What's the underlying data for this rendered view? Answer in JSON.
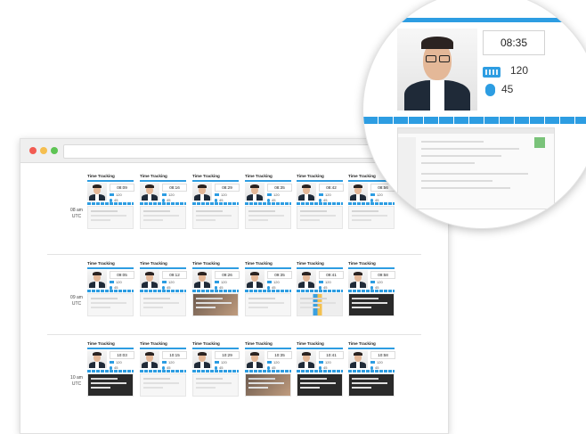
{
  "widget_title": "Time Tracking",
  "hours": [
    {
      "label_time": "08 am",
      "label_tz": "UTC",
      "cells": [
        {
          "time": "08:09",
          "keystrokes": "120",
          "clicks": "45",
          "shot": "plain"
        },
        {
          "time": "08:16",
          "keystrokes": "120",
          "clicks": "45",
          "shot": "plain"
        },
        {
          "time": "08:29",
          "keystrokes": "120",
          "clicks": "45",
          "shot": "plain"
        },
        {
          "time": "08:35",
          "keystrokes": "120",
          "clicks": "45",
          "shot": "plain"
        },
        {
          "time": "08:42",
          "keystrokes": "120",
          "clicks": "45",
          "shot": "plain"
        },
        {
          "time": "08:56",
          "keystrokes": "120",
          "clicks": "45",
          "shot": "plain"
        }
      ]
    },
    {
      "label_time": "09 am",
      "label_tz": "UTC",
      "cells": [
        {
          "time": "09:05",
          "keystrokes": "120",
          "clicks": "45",
          "shot": "plain"
        },
        {
          "time": "09:12",
          "keystrokes": "120",
          "clicks": "45",
          "shot": "plain"
        },
        {
          "time": "09:26",
          "keystrokes": "120",
          "clicks": "45",
          "shot": "img"
        },
        {
          "time": "09:35",
          "keystrokes": "120",
          "clicks": "45",
          "shot": "plain"
        },
        {
          "time": "09:41",
          "keystrokes": "120",
          "clicks": "45",
          "shot": "colour"
        },
        {
          "time": "09:58",
          "keystrokes": "120",
          "clicks": "45",
          "shot": "dark"
        }
      ]
    },
    {
      "label_time": "10 am",
      "label_tz": "UTC",
      "cells": [
        {
          "time": "10:03",
          "keystrokes": "120",
          "clicks": "45",
          "shot": "dark"
        },
        {
          "time": "10:15",
          "keystrokes": "120",
          "clicks": "45",
          "shot": "plain"
        },
        {
          "time": "10:29",
          "keystrokes": "120",
          "clicks": "45",
          "shot": "plain"
        },
        {
          "time": "10:35",
          "keystrokes": "120",
          "clicks": "45",
          "shot": "img"
        },
        {
          "time": "10:41",
          "keystrokes": "120",
          "clicks": "45",
          "shot": "dark"
        },
        {
          "time": "10:58",
          "keystrokes": "120",
          "clicks": "45",
          "shot": "dark"
        }
      ]
    }
  ],
  "zoom": {
    "time": "08:35",
    "keystrokes": "120",
    "clicks": "45"
  },
  "colors": {
    "accent": "#2d9de2",
    "dark_text": "#222222"
  },
  "icons": {
    "keyboard": "keyboard-icon",
    "mouse": "mouse-icon"
  }
}
